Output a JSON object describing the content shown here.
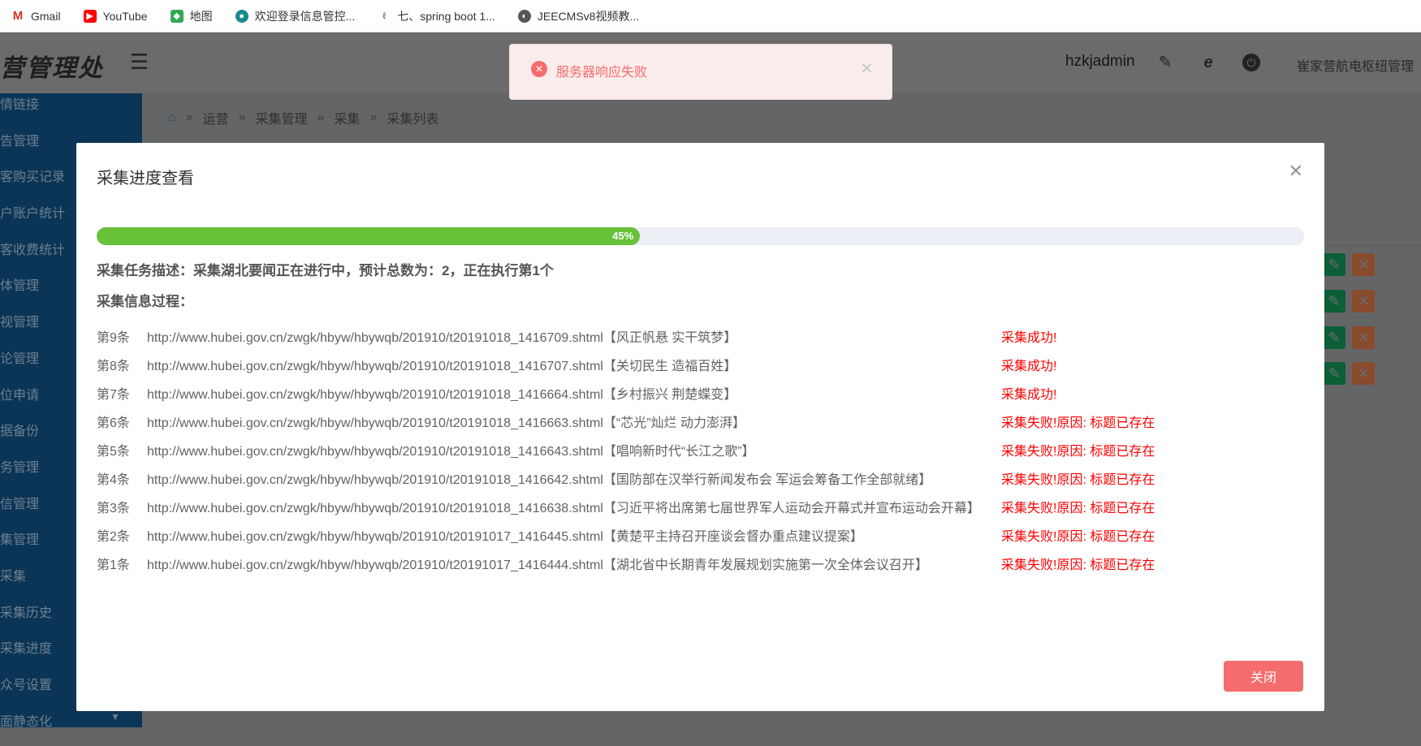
{
  "bookmarks": [
    {
      "label": "Gmail",
      "icon": "gmail-icon"
    },
    {
      "label": "YouTube",
      "icon": "youtube-icon"
    },
    {
      "label": "地图",
      "icon": "maps-icon"
    },
    {
      "label": "欢迎登录信息管控...",
      "icon": "globe-icon"
    },
    {
      "label": "七、spring boot 1...",
      "icon": "leaf-icon"
    },
    {
      "label": "JEECMSv8视频教...",
      "icon": "globe-icon"
    }
  ],
  "header": {
    "logo": "营管理处",
    "menu_icon": "☰",
    "username": "hzkjadmin",
    "org": "崔家营航电枢纽管理"
  },
  "sidebar": [
    "情链接",
    "告管理",
    "客购买记录",
    "户账户统计",
    "客收费统计",
    "体管理",
    "视管理",
    "论管理",
    "位申请",
    "据备份",
    "务管理",
    "信管理",
    "集管理",
    "采集",
    "采集历史",
    "采集进度",
    "众号设置",
    "面静态化"
  ],
  "breadcrumb": [
    "运营",
    "采集管理",
    "采集",
    "采集列表"
  ],
  "toast": {
    "message": "服务器响应失败"
  },
  "modal": {
    "title": "采集进度查看",
    "progress_percent": 45,
    "progress_label": "45%",
    "description": "采集任务描述：采集湖北要闻正在进行中，预计总数为：2，正在执行第1个",
    "process_label": "采集信息过程：",
    "items": [
      {
        "num": "第9条",
        "url": "http://www.hubei.gov.cn/zwgk/hbyw/hbywqb/201910/t20191018_1416709.shtml【风正帆悬 实干筑梦】",
        "status": "采集成功!"
      },
      {
        "num": "第8条",
        "url": "http://www.hubei.gov.cn/zwgk/hbyw/hbywqb/201910/t20191018_1416707.shtml【关切民生 造福百姓】",
        "status": "采集成功!"
      },
      {
        "num": "第7条",
        "url": "http://www.hubei.gov.cn/zwgk/hbyw/hbywqb/201910/t20191018_1416664.shtml【乡村振兴 荆楚蝶变】",
        "status": "采集成功!"
      },
      {
        "num": "第6条",
        "url": "http://www.hubei.gov.cn/zwgk/hbyw/hbywqb/201910/t20191018_1416663.shtml【“芯光”灿烂 动力澎湃】",
        "status": "采集失败!原因: 标题已存在"
      },
      {
        "num": "第5条",
        "url": "http://www.hubei.gov.cn/zwgk/hbyw/hbywqb/201910/t20191018_1416643.shtml【唱响新时代“长江之歌”】",
        "status": "采集失败!原因: 标题已存在"
      },
      {
        "num": "第4条",
        "url": "http://www.hubei.gov.cn/zwgk/hbyw/hbywqb/201910/t20191018_1416642.shtml【国防部在汉举行新闻发布会 军运会筹备工作全部就绪】",
        "status": "采集失败!原因: 标题已存在"
      },
      {
        "num": "第3条",
        "url": "http://www.hubei.gov.cn/zwgk/hbyw/hbywqb/201910/t20191018_1416638.shtml【习近平将出席第七届世界军人运动会开幕式并宣布运动会开幕】",
        "status": "采集失败!原因: 标题已存在"
      },
      {
        "num": "第2条",
        "url": "http://www.hubei.gov.cn/zwgk/hbyw/hbywqb/201910/t20191017_1416445.shtml【黄楚平主持召开座谈会督办重点建议提案】",
        "status": "采集失败!原因: 标题已存在"
      },
      {
        "num": "第1条",
        "url": "http://www.hubei.gov.cn/zwgk/hbyw/hbywqb/201910/t20191017_1416444.shtml【湖北省中长期青年发展规划实施第一次全体会议召开】",
        "status": "采集失败!原因: 标题已存在"
      }
    ],
    "close_label": "关闭"
  },
  "colors": {
    "progress": "#67c23a",
    "error": "#f56c6c",
    "status_fail": "#ff0000"
  }
}
